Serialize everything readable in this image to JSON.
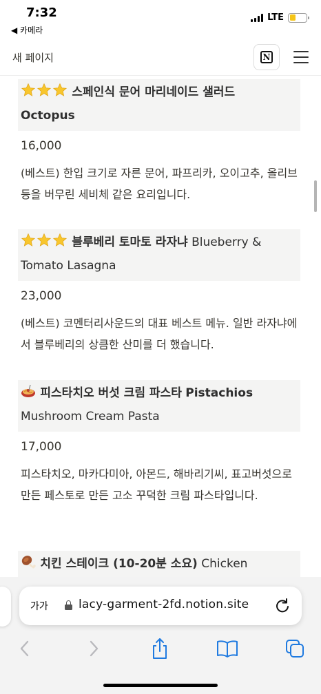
{
  "status_bar": {
    "time": "7:32",
    "back_label": "◀ 카메라",
    "network": "LTE",
    "battery_level": 0.35
  },
  "header": {
    "page_title": "새 페이지",
    "notion_logo": "N",
    "notion_icon": "notion-logo-icon",
    "menu_icon": "hamburger-menu-icon"
  },
  "items": [
    {
      "title_ko": "스페인식 문어 마리네이드 샐러드",
      "title_en": "Octopus",
      "price": "16,000",
      "description": "(베스트) 한입 크기로 자른 문어, 파프리카, 오이고추, 올리브 등을 버무린 세비체 같은 요리입니다.",
      "icon": "three-stars"
    },
    {
      "title_ko": "블루베리 토마토 라자냐",
      "title_en": "Blueberry & Tomato Lasagna",
      "price": "23,000",
      "description": "(베스트) 코멘터리사운드의 대표 베스트 메뉴. 일반 라자냐에서 블루베리의 상큼한 산미를 더 했습니다.",
      "icon": "three-stars"
    },
    {
      "title_ko": "피스타치오 버섯 크림 파스타",
      "title_en_bold": "Pistachios",
      "title_en": "Mushroom Cream Pasta",
      "price": "17,000",
      "description": "피스타치오, 마카다미아, 아몬드, 해바리기씨, 표고버섯으로 만든 페스토로 만든 고소 꾸덕한 크림 파스타입니다.",
      "icon": "pasta-icon"
    },
    {
      "title_ko": "치킨 스테이크 (10-20분 소요)",
      "title_en": "Chicken",
      "icon": "chicken-leg-icon"
    }
  ],
  "browser": {
    "aa_label": "가가",
    "url": "lacy-garment-2fd.notion.site",
    "colors": {
      "background": "#f3f3f3",
      "accent": "#1f7ae0",
      "disabled": "#b9b9bd"
    }
  }
}
